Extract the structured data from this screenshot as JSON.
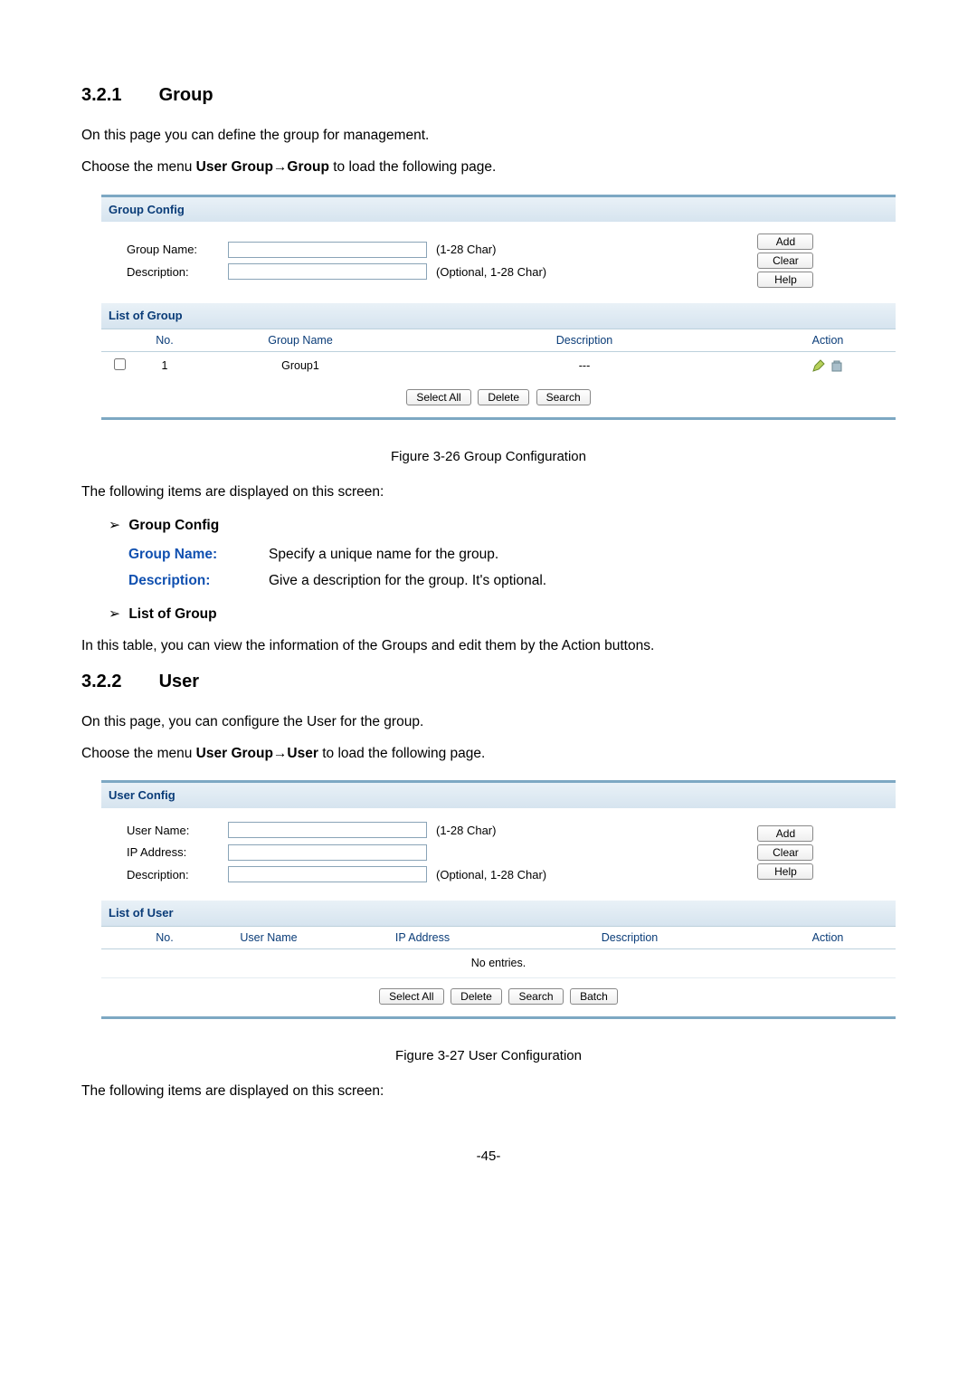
{
  "sections": {
    "group": {
      "num": "3.2.1",
      "title": "Group",
      "intro": "On this page you can define the group for management.",
      "choosePrefix": "Choose the menu ",
      "choosePath": "User Group→Group",
      "chooseSuffix": " to load the following page."
    },
    "user": {
      "num": "3.2.2",
      "title": "User",
      "intro": "On this page, you can configure the User for the group.",
      "choosePrefix": "Choose the menu ",
      "choosePath": "User Group→User",
      "chooseSuffix": " to load the following page."
    }
  },
  "groupPanel": {
    "configTitle": "Group Config",
    "listTitle": "List of Group",
    "labels": {
      "groupName": "Group Name:",
      "description": "Description:"
    },
    "hints": {
      "groupName": "(1-28 Char)",
      "description": "(Optional, 1-28 Char)"
    },
    "buttons": {
      "add": "Add",
      "clear": "Clear",
      "help": "Help",
      "selectAll": "Select All",
      "delete": "Delete",
      "search": "Search"
    },
    "columns": {
      "no": "No.",
      "name": "Group Name",
      "desc": "Description",
      "action": "Action"
    },
    "rows": [
      {
        "no": "1",
        "name": "Group1",
        "desc": "---"
      }
    ]
  },
  "userPanel": {
    "configTitle": "User Config",
    "listTitle": "List of User",
    "labels": {
      "userName": "User Name:",
      "ip": "IP Address:",
      "description": "Description:"
    },
    "hints": {
      "userName": "(1-28 Char)",
      "description": "(Optional, 1-28 Char)"
    },
    "buttons": {
      "add": "Add",
      "clear": "Clear",
      "help": "Help",
      "selectAll": "Select All",
      "delete": "Delete",
      "search": "Search",
      "batch": "Batch"
    },
    "columns": {
      "no": "No.",
      "name": "User Name",
      "ip": "IP Address",
      "desc": "Description",
      "action": "Action"
    },
    "noEntries": "No entries."
  },
  "figures": {
    "group": "Figure 3-26 Group Configuration",
    "user": "Figure 3-27 User Configuration"
  },
  "explain": {
    "lead": "The following items are displayed on this screen:",
    "groupHead": "Group Config",
    "groupNameTerm": "Group Name:",
    "groupNameText": "Specify a unique name for the group.",
    "descriptionTerm": "Description:",
    "descriptionText": "Give a description for the group. It's optional.",
    "listHead": "List of Group",
    "listText": "In this table, you can view the information of the Groups and edit them by the Action buttons."
  },
  "pageNum": "-45-"
}
